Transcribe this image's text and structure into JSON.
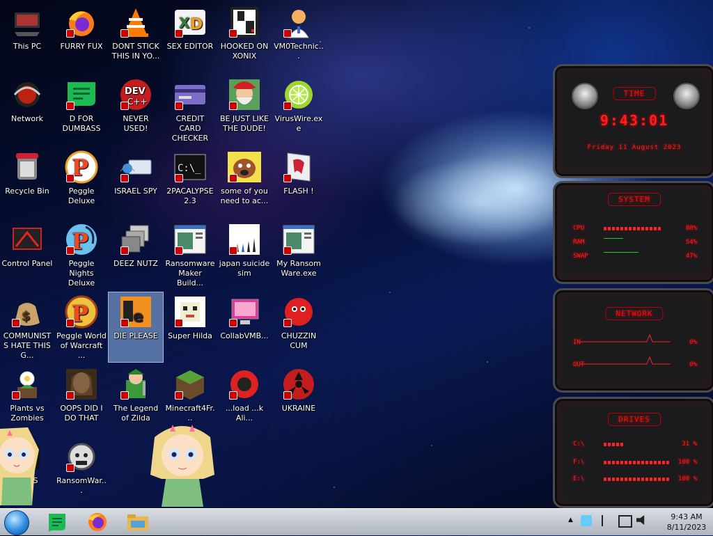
{
  "desktop": {
    "icons": [
      {
        "label": "This PC"
      },
      {
        "label": "FURRY FUX"
      },
      {
        "label": "DONT STICK THIS IN YO..."
      },
      {
        "label": "SEX EDITOR"
      },
      {
        "label": "HOOKED ON XONIX"
      },
      {
        "label": "VM0Technic..."
      },
      {
        "label": "Network"
      },
      {
        "label": "D FOR DUMBASS"
      },
      {
        "label": "NEVER USED!"
      },
      {
        "label": "CREDIT CARD CHECKER"
      },
      {
        "label": "BE JUST LIKE THE DUDE!"
      },
      {
        "label": "VirusWire.exe"
      },
      {
        "label": "Recycle Bin"
      },
      {
        "label": "Peggle Deluxe"
      },
      {
        "label": "ISRAEL SPY"
      },
      {
        "label": "2PACALYPSE 2.3"
      },
      {
        "label": "some of you need to ac..."
      },
      {
        "label": "FLASH !"
      },
      {
        "label": "Control Panel"
      },
      {
        "label": "Peggle Nights Deluxe"
      },
      {
        "label": "DEEZ NUTZ"
      },
      {
        "label": "Ransomware Maker Build..."
      },
      {
        "label": "japan suicide sim"
      },
      {
        "label": "My Ransom Ware.exe"
      },
      {
        "label": "COMMUNISTS HATE THIS G..."
      },
      {
        "label": "Peggle World of Warcraft ..."
      },
      {
        "label": "DIE PLEASE"
      },
      {
        "label": "Super Hilda"
      },
      {
        "label": "CollabVMB..."
      },
      {
        "label": "CHUZZIN CUM"
      },
      {
        "label": "Plants vs Zombies"
      },
      {
        "label": "OOPS DID I DO THAT"
      },
      {
        "label": "The Legend of Zilda"
      },
      {
        "label": "Minecraft4Fr..."
      },
      {
        "label": "...load ...k Ali..."
      },
      {
        "label": "UKRAINE"
      },
      {
        "label": "OOPS"
      },
      {
        "label": "RansomWar..."
      }
    ],
    "dev_badge": "DEV",
    "dev_sub": "C++",
    "cmd_text": "C:\\_"
  },
  "widgets": {
    "time": {
      "header": "TIME",
      "clock": "9:43:01",
      "date": "Friday 11 August 2023"
    },
    "system": {
      "header": "SYSTEM",
      "rows": [
        {
          "label": "CPU",
          "value": "88%",
          "level": 0.88
        },
        {
          "label": "RAM",
          "value": "54%",
          "level": 0.54
        },
        {
          "label": "SWAP",
          "value": "47%",
          "level": 0.47
        }
      ]
    },
    "network": {
      "header": "NETWORK",
      "rows": [
        {
          "label": "IN",
          "value": "0%"
        },
        {
          "label": "OUT",
          "value": "0%"
        }
      ]
    },
    "drives": {
      "header": "DRIVES",
      "rows": [
        {
          "label": "C:\\",
          "value": "31 %",
          "level": 0.31
        },
        {
          "label": "F:\\",
          "value": "100 %",
          "level": 1.0
        },
        {
          "label": "E:\\",
          "value": "100 %",
          "level": 1.0
        }
      ]
    }
  },
  "taskbar": {
    "pinned": [
      "start-orb",
      "docs-app",
      "firefox",
      "file-explorer"
    ],
    "tray_arrow": "▲",
    "time": "9:43 AM",
    "date": "8/11/2023"
  }
}
